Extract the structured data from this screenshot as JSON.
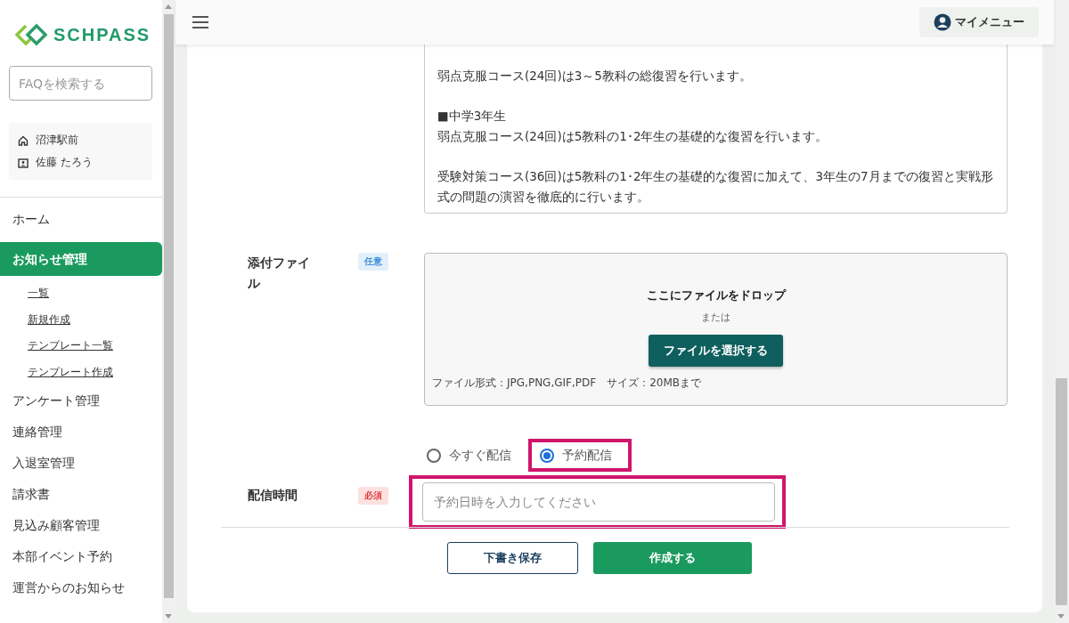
{
  "sidebar": {
    "logo": "SCHPASS",
    "search": {
      "placeholder": "FAQを検索する"
    },
    "info": [
      {
        "kind": "school",
        "text": "沼津駅前"
      },
      {
        "kind": "user",
        "text": "佐藤 たろう"
      }
    ],
    "items": [
      {
        "label": "ホーム",
        "selected": false
      },
      {
        "label": "お知らせ管理",
        "selected": true,
        "children": [
          {
            "label": "一覧"
          },
          {
            "label": "新規作成"
          },
          {
            "label": "テンプレート一覧"
          },
          {
            "label": "テンプレート作成"
          }
        ]
      },
      {
        "label": "アンケート管理",
        "selected": false
      },
      {
        "label": "連絡管理",
        "selected": false
      },
      {
        "label": "入退室管理",
        "selected": false
      },
      {
        "label": "請求書",
        "selected": false
      },
      {
        "label": "見込み顧客管理",
        "selected": false
      },
      {
        "label": "本部イベント予約",
        "selected": false
      },
      {
        "label": "運営からのお知らせ",
        "selected": false
      }
    ]
  },
  "header": {
    "menu_button": "マイメニュー"
  },
  "body_text": [
    [
      "弱点克服コース(24回)は3～5教科の総復習を行います。"
    ],
    [
      "■中学3年生",
      "弱点克服コース(24回)は5教科の1･2年生の基礎的な復習を行います。"
    ],
    [
      "受験対策コース(36回)は5教科の1･2年生の基礎的な復習に加えて、3年生の7月までの復習と実戦形式の問題の演習を徹底的に行います。"
    ]
  ],
  "attachment": {
    "label": "添付ファイル",
    "badge": {
      "kind": "optional",
      "text": "任意"
    },
    "drop_text": "ここにファイルをドロップ",
    "or_text": "または",
    "button": "ファイルを選択する",
    "note": "ファイル形式：JPG,PNG,GIF,PDF　サイズ：20MBまで"
  },
  "delivery": {
    "label": "配信時間",
    "badge": {
      "kind": "required",
      "text": "必須"
    },
    "options": [
      {
        "label": "今すぐ配信",
        "selected": false,
        "highlighted": false
      },
      {
        "label": "予約配信",
        "selected": true,
        "highlighted": true
      }
    ],
    "input": {
      "placeholder": "予約日時を入力してください",
      "highlighted": true
    }
  },
  "buttons": [
    {
      "kind": "secondary",
      "label": "下書き保存"
    },
    {
      "kind": "primary",
      "label": "作成する"
    }
  ]
}
